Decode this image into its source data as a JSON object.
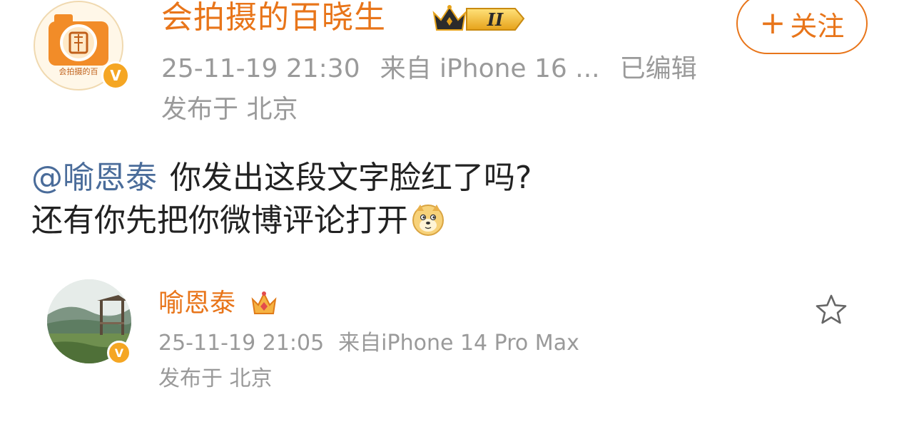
{
  "post": {
    "author": {
      "name": "会拍摄的百晓生",
      "avatar_text": "会拍摄的百"
    },
    "meta": {
      "timestamp": "25-11-19 21:30",
      "source": "来自 iPhone 16 ...",
      "edited": "已编辑",
      "location": "发布于 北京"
    },
    "follow_button": {
      "plus": "+",
      "label": "关注"
    },
    "body": {
      "mention": "@喻恩泰",
      "line1": "你发出这段文字脸红了吗?",
      "line2": "还有你先把你微博评论打开"
    },
    "badge_level": "II",
    "verified_mark": "V"
  },
  "quoted": {
    "author": {
      "name": "喻恩泰"
    },
    "meta": {
      "timestamp": "25-11-19 21:05",
      "source": "来自iPhone 14 Pro Max",
      "location": "发布于 北京"
    },
    "verified_mark": "V"
  },
  "colors": {
    "accent_orange": "#e8751a",
    "mention_blue": "#4a6c9a",
    "meta_gray": "#9a9a9a",
    "verified_gold": "#f5a623"
  },
  "icons": {
    "crown_badge": "crown-level-icon",
    "reply_crown": "crown-icon",
    "favorite": "star-outline-icon",
    "emoji": "doge-emoji"
  }
}
